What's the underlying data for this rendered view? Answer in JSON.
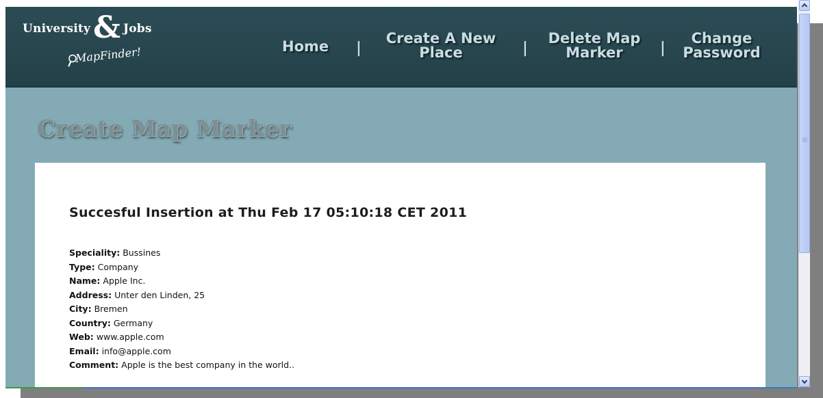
{
  "logo": {
    "line1_left": "University",
    "ampersand": "&",
    "line1_right": "Jobs",
    "line2": "MapFinder!"
  },
  "nav": {
    "home": "Home",
    "create_line1": "Create A New",
    "create_line2": "Place",
    "delete_line1": "Delete Map",
    "delete_line2": "Marker",
    "change_line1": "Change",
    "change_line2": "Password",
    "separator": "|"
  },
  "page_title": "Create Map Marker",
  "result": {
    "message": "Succesful Insertion at Thu Feb 17 05:10:18 CET 2011",
    "fields": [
      {
        "label": "Speciality:",
        "value": "Bussines"
      },
      {
        "label": "Type:",
        "value": "Company"
      },
      {
        "label": "Name:",
        "value": "Apple Inc."
      },
      {
        "label": "Address:",
        "value": "Unter den Linden, 25"
      },
      {
        "label": "City:",
        "value": "Bremen"
      },
      {
        "label": "Country:",
        "value": "Germany"
      },
      {
        "label": "Web:",
        "value": "www.apple.com"
      },
      {
        "label": "Email:",
        "value": "info@apple.com"
      },
      {
        "label": "Comment:",
        "value": "Apple is the best company in the world.."
      }
    ]
  },
  "colors": {
    "header_bg": "#2c4c55",
    "page_bg": "#84abb5",
    "nav_text": "#c9dde2",
    "card_bg": "#ffffff"
  },
  "icons": {
    "logo_mark": "magnifier-icon",
    "scroll_up": "chevron-up-icon",
    "scroll_down": "chevron-down-icon"
  }
}
